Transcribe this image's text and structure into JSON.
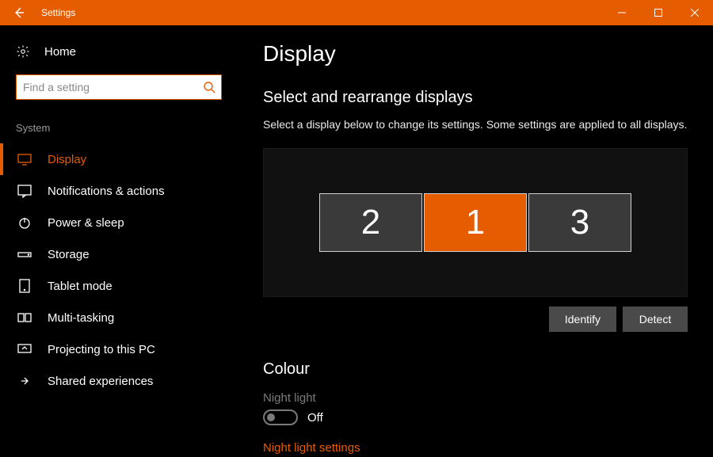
{
  "titlebar": {
    "title": "Settings"
  },
  "sidebar": {
    "home": "Home",
    "search_placeholder": "Find a setting",
    "section": "System",
    "items": [
      {
        "label": "Display",
        "active": true
      },
      {
        "label": "Notifications & actions",
        "active": false
      },
      {
        "label": "Power & sleep",
        "active": false
      },
      {
        "label": "Storage",
        "active": false
      },
      {
        "label": "Tablet mode",
        "active": false
      },
      {
        "label": "Multi-tasking",
        "active": false
      },
      {
        "label": "Projecting to this PC",
        "active": false
      },
      {
        "label": "Shared experiences",
        "active": false
      }
    ]
  },
  "main": {
    "heading": "Display",
    "subheading": "Select and rearrange displays",
    "description": "Select a display below to change its settings. Some settings are applied to all displays.",
    "displays": [
      {
        "id": "2",
        "selected": false
      },
      {
        "id": "1",
        "selected": true
      },
      {
        "id": "3",
        "selected": false
      }
    ],
    "identify_btn": "Identify",
    "detect_btn": "Detect",
    "colour": {
      "heading": "Colour",
      "night_label": "Night light",
      "toggle_state": "Off",
      "night_link": "Night light settings"
    }
  },
  "colors": {
    "accent": "#e65c00"
  }
}
